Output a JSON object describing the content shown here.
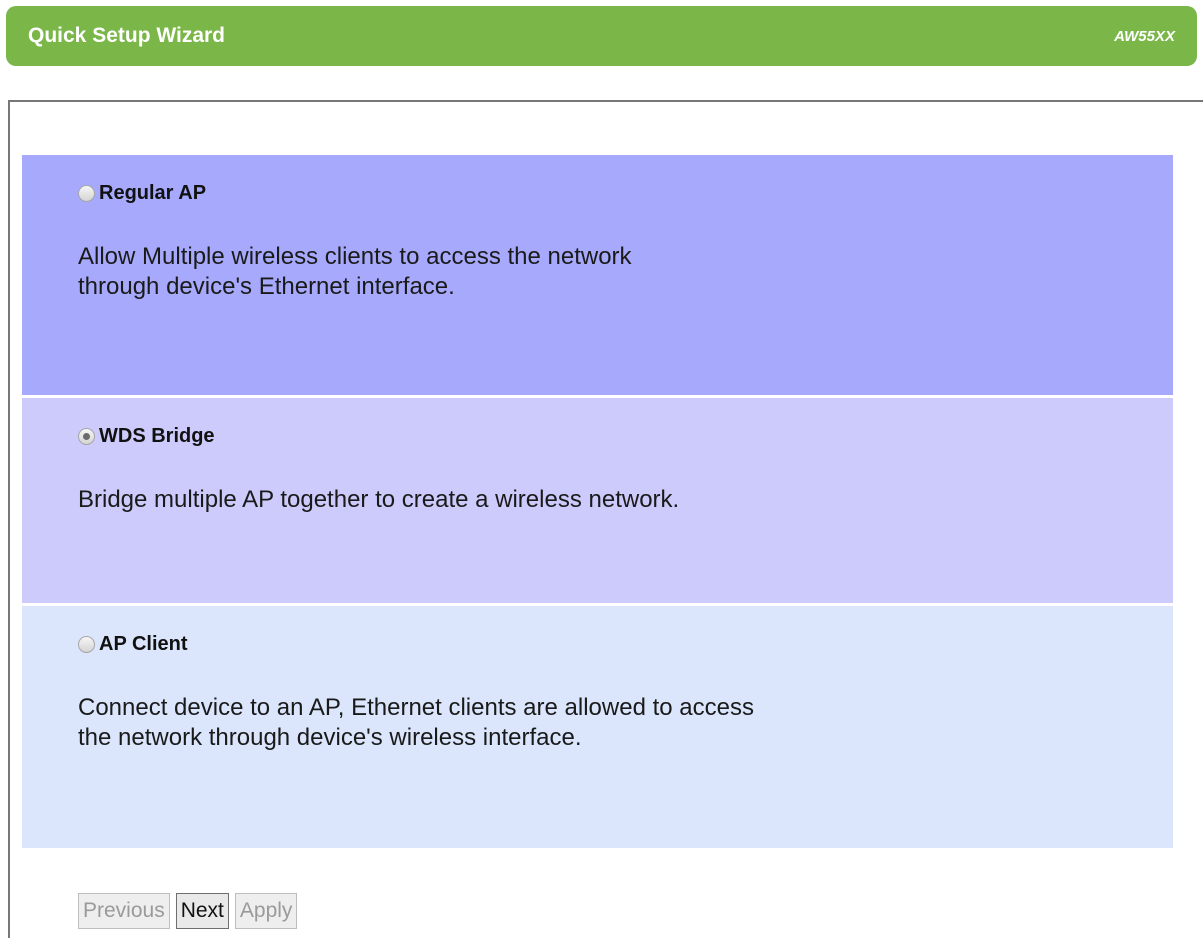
{
  "header": {
    "title": "Quick Setup Wizard",
    "model": "AW55XX",
    "color": "#7ab648"
  },
  "options": [
    {
      "label": "Regular AP",
      "description_lines": [
        "Allow Multiple wireless clients to access the network",
        "through device's Ethernet interface."
      ],
      "selected": false,
      "background": "#a7a9fc"
    },
    {
      "label": "WDS Bridge",
      "description_lines": [
        "Bridge multiple AP together to create a wireless network."
      ],
      "selected": true,
      "background": "#cccbfc"
    },
    {
      "label": "AP Client",
      "description_lines": [
        "Connect device to an AP, Ethernet clients are allowed to access",
        "the network through device's wireless interface."
      ],
      "selected": false,
      "background": "#dbe6fc"
    }
  ],
  "buttons": {
    "previous": {
      "label": "Previous",
      "enabled": false
    },
    "next": {
      "label": "Next",
      "enabled": true
    },
    "apply": {
      "label": "Apply",
      "enabled": false
    }
  }
}
